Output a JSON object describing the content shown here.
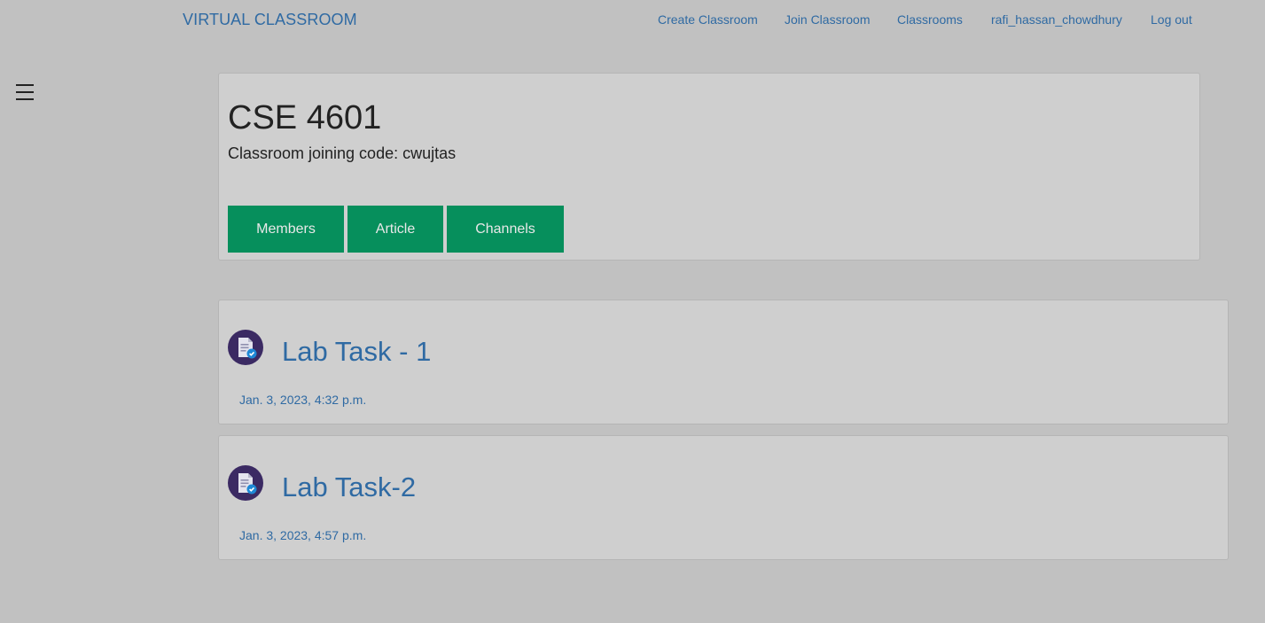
{
  "nav": {
    "brand": "VIRTUAL CLASSROOM",
    "links": [
      "Create Classroom",
      "Join Classroom",
      "Classrooms",
      "rafi_hassan_chowdhury",
      "Log out"
    ]
  },
  "classroom": {
    "title": "CSE 4601",
    "join_code_text": "Classroom joining code: cwujtas",
    "buttons": [
      "Members",
      "Article",
      "Channels"
    ]
  },
  "tasks": [
    {
      "title": "Lab Task - 1",
      "date": "Jan. 3, 2023, 4:32 p.m."
    },
    {
      "title": "Lab Task-2",
      "date": "Jan. 3, 2023, 4:57 p.m."
    }
  ],
  "colors": {
    "background": "#c1c1c1",
    "card": "#cfcfcf",
    "link": "#2f6aa3",
    "button": "#068f5c",
    "icon_circle": "#3b2a63"
  },
  "icons": {
    "menu": "hamburger-menu-icon",
    "task": "assignment-document-icon"
  }
}
